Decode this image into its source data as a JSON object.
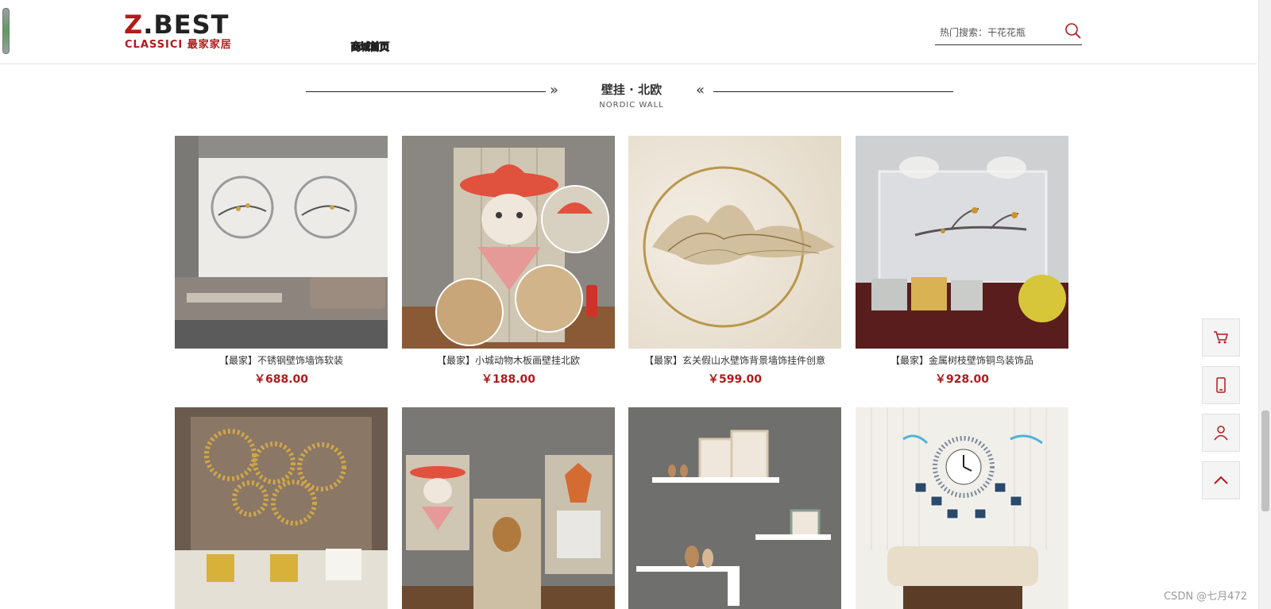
{
  "header": {
    "logo": {
      "brand_mark": "Z",
      "brand_rest": ".BEST",
      "sub_latin": "CLASSICI",
      "sub_cn": "最家家居"
    },
    "nav_garbled": "商城首页",
    "search": {
      "placeholder": "热门搜索：干花花瓶"
    }
  },
  "section": {
    "title": "壁挂 · 北欧",
    "subtitle": "NORDIC WALL",
    "arrow_left": "»",
    "arrow_right": "«"
  },
  "products": [
    {
      "name": "【最家】不锈钢壁饰墙饰软装",
      "price": "￥688.00"
    },
    {
      "name": "【最家】小城动物木板画壁挂北欧",
      "price": "￥188.00"
    },
    {
      "name": "【最家】玄关假山水壁饰背景墙饰挂件创意",
      "price": "￥599.00"
    },
    {
      "name": "【最家】金属树枝壁饰铜鸟装饰品",
      "price": "￥928.00"
    },
    {
      "name": "",
      "price": ""
    },
    {
      "name": "",
      "price": ""
    },
    {
      "name": "",
      "price": ""
    },
    {
      "name": "",
      "price": ""
    }
  ],
  "side_toolbar": [
    {
      "icon": "cart-icon"
    },
    {
      "icon": "mobile-icon"
    },
    {
      "icon": "user-icon"
    },
    {
      "icon": "chevron-up-icon"
    }
  ],
  "watermark": "CSDN @七月472",
  "colors": {
    "accent": "#b01b1b",
    "divider": "#222222"
  }
}
